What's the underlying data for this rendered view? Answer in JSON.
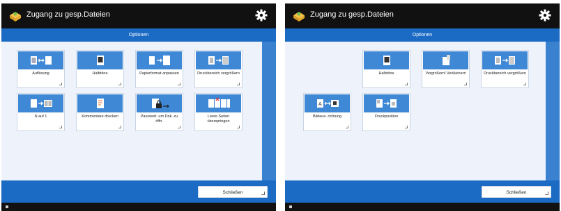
{
  "colors": {
    "accent": "#1b6bc4",
    "tile_icon_bg": "#3f88d6",
    "content_bg": "#eef3fb"
  },
  "screens": [
    {
      "title": "Zugang zu gesp.Dateien",
      "options_label": "Optionen",
      "close_label": "Schließen",
      "tiles": [
        {
          "label": "Auflösung",
          "icon": "resolution-icon"
        },
        {
          "label": "Halbtöne",
          "icon": "halftone-icon"
        },
        {
          "label": "Papierformat anpassen",
          "icon": "fit-paper-size-icon"
        },
        {
          "label": "Druckbereich vergrößern",
          "icon": "enlarge-print-area-icon"
        },
        {
          "label": "N auf 1",
          "icon": "n-on-1-icon"
        },
        {
          "label": "Kommentare drucken",
          "icon": "print-comments-icon"
        },
        {
          "label": "Passwort. um Dok. zu öffn.",
          "icon": "password-open-doc-icon"
        },
        {
          "label": "Leere Seiten überspringen",
          "icon": "skip-blank-pages-icon"
        }
      ]
    },
    {
      "title": "Zugang zu gesp.Dateien",
      "options_label": "Optionen",
      "close_label": "Schließen",
      "tiles": [
        {
          "label": "Halbtöne",
          "icon": "halftone-icon"
        },
        {
          "label": "Vergrößern/ Verkleinern",
          "icon": "enlarge-reduce-icon"
        },
        {
          "label": "Druckbereich vergrößern",
          "icon": "enlarge-print-area-icon"
        },
        {
          "label": "Bildaus- richtung",
          "icon": "image-orientation-icon"
        },
        {
          "label": "Druckposition",
          "icon": "print-position-icon"
        }
      ]
    }
  ]
}
